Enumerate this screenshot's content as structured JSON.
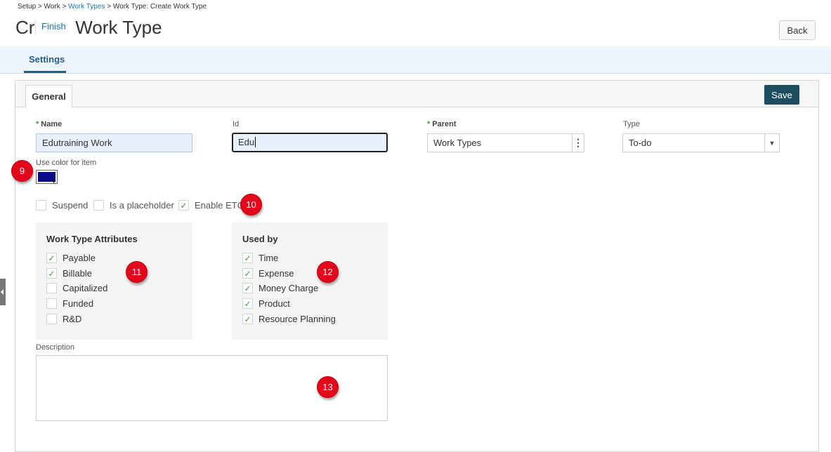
{
  "breadcrumb": {
    "part1": "Setup > Work > ",
    "link": "Work Types",
    "part2": " > Work Type: Create Work Type"
  },
  "header": {
    "title": "Create Work Type",
    "finish_label": "Finish",
    "back_label": "Back"
  },
  "tabs": {
    "settings_label": "Settings",
    "general_label": "General"
  },
  "toolbar": {
    "save_label": "Save"
  },
  "form": {
    "name_label": "Name",
    "name_value": "Edutraining Work",
    "id_label": "Id",
    "id_value": "Edu",
    "parent_label": "Parent",
    "parent_value": "Work Types",
    "type_label": "Type",
    "type_value": "To-do",
    "color_label": "Use color for item",
    "color_value": "#0a0a8a",
    "suspend_label": "Suspend",
    "placeholder_label": "Is a placeholder",
    "etc_label": "Enable ETC",
    "description_label": "Description"
  },
  "attributes": {
    "title": "Work Type Attributes",
    "items": [
      {
        "label": "Payable",
        "checked": true
      },
      {
        "label": "Billable",
        "checked": true
      },
      {
        "label": "Capitalized",
        "checked": false
      },
      {
        "label": "Funded",
        "checked": false
      },
      {
        "label": "R&D",
        "checked": false
      }
    ]
  },
  "used_by": {
    "title": "Used by",
    "items": [
      {
        "label": "Time",
        "checked": true
      },
      {
        "label": "Expense",
        "checked": true
      },
      {
        "label": "Money Charge",
        "checked": true
      },
      {
        "label": "Product",
        "checked": true
      },
      {
        "label": "Resource Planning",
        "checked": true
      }
    ]
  },
  "badges": {
    "b9": "9",
    "b10": "10",
    "b11": "11",
    "b12": "12",
    "b13": "13"
  },
  "colors": {
    "accent": "#1f5f8b",
    "save_bg": "#1d4e5f",
    "badge": "#e3071b",
    "check": "#3a9a3a"
  }
}
